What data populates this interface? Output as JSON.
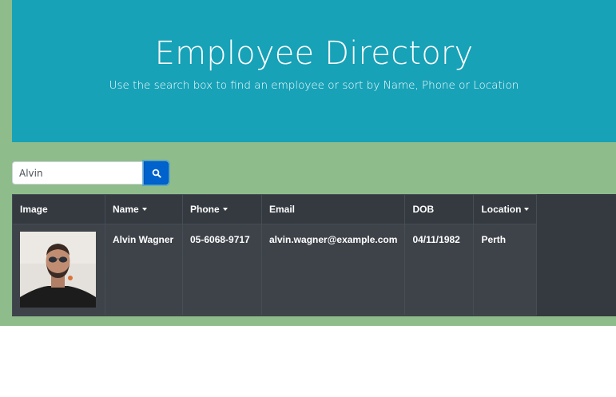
{
  "header": {
    "title": "Employee Directory",
    "subtitle": "Use the search box to find an employee or sort by Name, Phone or Location"
  },
  "search": {
    "value": "Alvin",
    "button_icon": "search-icon"
  },
  "table": {
    "columns": [
      {
        "label": "Image",
        "sortable": false
      },
      {
        "label": "Name",
        "sortable": true
      },
      {
        "label": "Phone",
        "sortable": true
      },
      {
        "label": "Email",
        "sortable": false
      },
      {
        "label": "DOB",
        "sortable": false
      },
      {
        "label": "Location",
        "sortable": true
      }
    ],
    "rows": [
      {
        "name": "Alvin Wagner",
        "phone": "05-6068-9717",
        "email": "alvin.wagner@example.com",
        "dob": "04/11/1982",
        "location": "Perth"
      }
    ]
  },
  "colors": {
    "page_background": "#8fbc8b",
    "header_background": "#17a2b8",
    "table_background": "#343a40",
    "search_button": "#0062cc"
  }
}
